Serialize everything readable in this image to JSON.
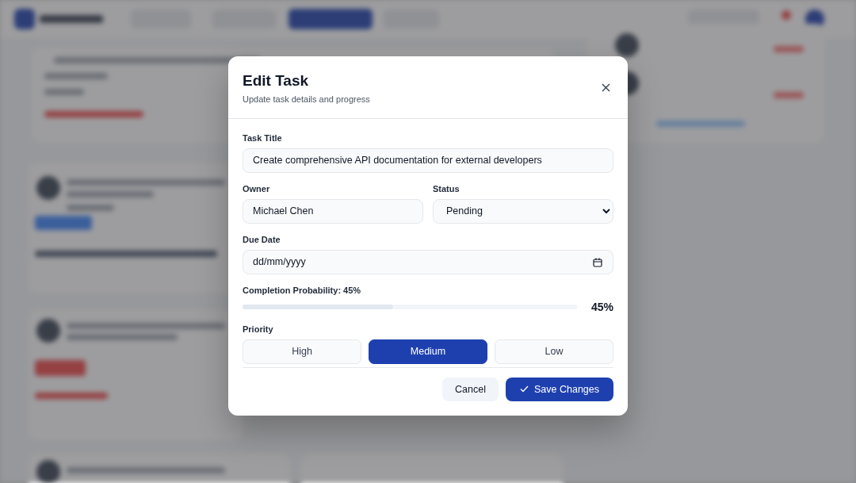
{
  "dialog": {
    "title": "Edit Task",
    "subtitle": "Update task details and progress",
    "fields": {
      "title": {
        "label": "Task Title",
        "value": "Create comprehensive API documentation for external developers"
      },
      "owner": {
        "label": "Owner",
        "value": "Michael Chen"
      },
      "status": {
        "label": "Status",
        "value": "Pending"
      },
      "due_date": {
        "label": "Due Date",
        "placeholder": "dd/mm/yyyy"
      },
      "probability": {
        "label": "Completion Probability: 45%",
        "level": 0.45,
        "reading": "45%"
      },
      "priority": {
        "label": "Priority",
        "options": [
          {
            "label": "High",
            "selected": false
          },
          {
            "label": "Medium",
            "selected": true
          },
          {
            "label": "Low",
            "selected": false
          }
        ]
      }
    },
    "buttons": {
      "cancel": "Cancel",
      "save": "Save Changes"
    }
  }
}
